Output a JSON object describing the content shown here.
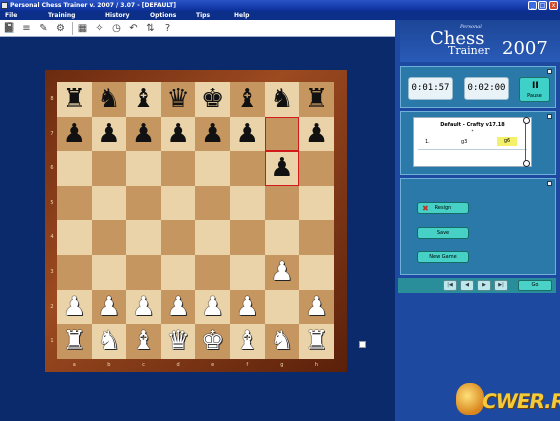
{
  "window": {
    "title": "Personal Chess Trainer v. 2007 / 3.07 - [DEFAULT]",
    "buttons": {
      "minimize": "_",
      "maximize": "□",
      "close": "x"
    }
  },
  "menu": [
    "File",
    "Training",
    "History",
    "Options",
    "Tips",
    "Help"
  ],
  "toolbar": {
    "icons": [
      "notebook-icon",
      "list-icon",
      "edit-icon",
      "tools-icon",
      "board-icon",
      "wand-icon",
      "clock-icon",
      "arrow-icon",
      "flip-icon",
      "question-icon"
    ],
    "glyphs": [
      "📓",
      "≡",
      "✎",
      "⚙",
      "▦",
      "✧",
      "◷",
      "↶",
      "⇅",
      "?"
    ]
  },
  "board": {
    "files": [
      "a",
      "b",
      "c",
      "d",
      "e",
      "f",
      "g",
      "h"
    ],
    "ranks": [
      "8",
      "7",
      "6",
      "5",
      "4",
      "3",
      "2",
      "1"
    ],
    "light_color": "#ead3a8",
    "dark_color": "#c59660",
    "highlight_color": "#d21a1a",
    "highlighted_squares": [
      "g7",
      "g6"
    ],
    "position": [
      [
        "r",
        "n",
        "b",
        "q",
        "k",
        "b",
        "n",
        "r"
      ],
      [
        "p",
        "p",
        "p",
        "p",
        "p",
        "p",
        "",
        "p"
      ],
      [
        "",
        "",
        "",
        "",
        "",
        "",
        "p",
        ""
      ],
      [
        "",
        "",
        "",
        "",
        "",
        "",
        "",
        ""
      ],
      [
        "",
        "",
        "",
        "",
        "",
        "",
        "",
        ""
      ],
      [
        "",
        "",
        "",
        "",
        "",
        "",
        "P",
        ""
      ],
      [
        "P",
        "P",
        "P",
        "P",
        "P",
        "P",
        "",
        "P"
      ],
      [
        "R",
        "N",
        "B",
        "Q",
        "K",
        "B",
        "N",
        "R"
      ]
    ]
  },
  "logo": {
    "personal": "Personal",
    "chess": "Chess",
    "trainer": "Trainer",
    "year": "2007"
  },
  "clocks": {
    "white": "0:01:57",
    "black": "0:02:00"
  },
  "pause": {
    "icon": "II",
    "label": "Pause"
  },
  "notation": {
    "header": "Default - Crafty v17.18",
    "marker": "*",
    "moves": [
      {
        "num": "1.",
        "white": "g3",
        "black": "g6"
      }
    ]
  },
  "actions": {
    "resign": "Resign",
    "save": "Save",
    "new_game": "New Game"
  },
  "navigation": {
    "first": "|◀",
    "prev": "◀",
    "next": "▶",
    "last": "▶|",
    "go": "Go"
  },
  "watermark": {
    "text": "CWER.RU"
  },
  "colors": {
    "background": "#0a2a6b",
    "panel": "#2b79a8",
    "button": "#46d0c6"
  }
}
